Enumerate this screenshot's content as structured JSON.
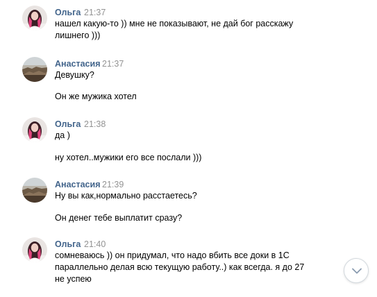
{
  "messages": [
    {
      "author": "Ольга",
      "time": "21:37",
      "avatar": "photo-woman-pink-hair",
      "lines": [
        "нашел какую-то )) мне не показывают, не дай бог расскажу",
        "лишнего )))"
      ]
    },
    {
      "author": "Анастасия",
      "time": "21:37",
      "avatar": "photo-landscape",
      "lines": [
        "Девушку?",
        "Он же мужика хотел"
      ]
    },
    {
      "author": "Ольга",
      "time": "21:38",
      "avatar": "photo-woman-pink-hair",
      "lines": [
        "да )",
        "ну хотел..мужики его все послали )))"
      ]
    },
    {
      "author": "Анастасия",
      "time": "21:39",
      "avatar": "photo-landscape",
      "lines": [
        "Ну вы как,нормально расстаетесь?",
        "Он денег тебе выплатит сразу?"
      ]
    },
    {
      "author": "Ольга",
      "time": "21:40",
      "avatar": "photo-woman-pink-hair",
      "lines": [
        "сомневаюсь )) он придумал, что надо вбить все доки в 1С",
        "параллельно делая всю текущую работу..) как всегда. я до 27",
        "не успею"
      ]
    }
  ],
  "scroll_button": {
    "icon": "chevron-down-icon"
  },
  "colors": {
    "author_name": "#42648b",
    "timestamp": "#939393",
    "text": "#000000",
    "background": "#ffffff"
  }
}
